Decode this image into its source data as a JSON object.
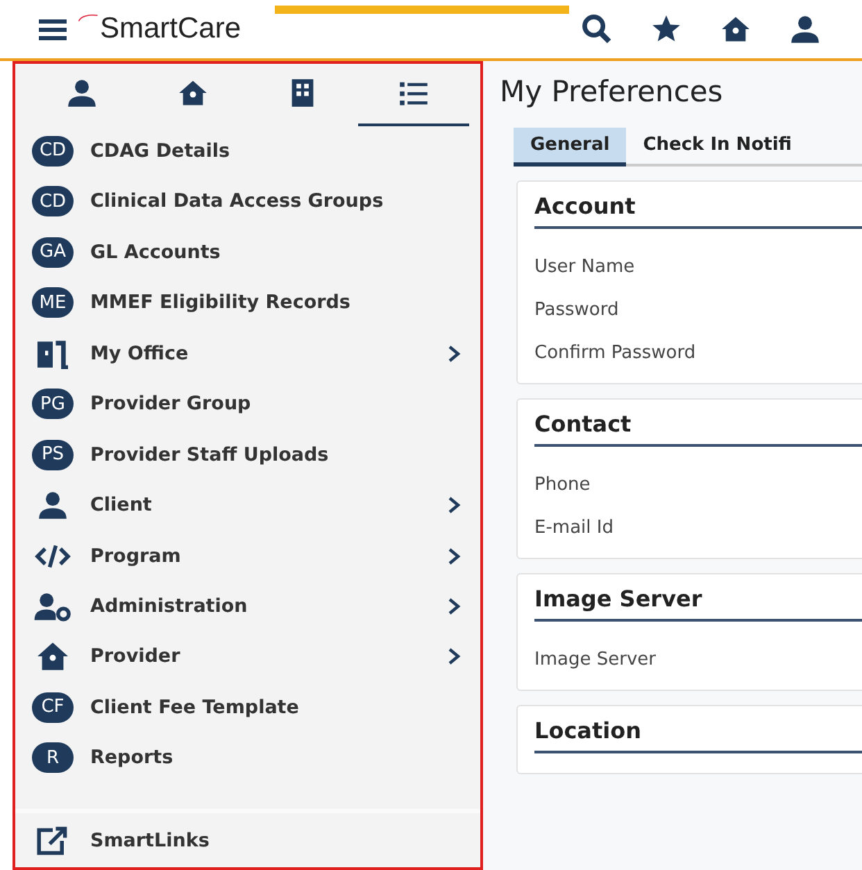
{
  "header": {
    "logo": "SmartCare"
  },
  "sidebar": {
    "tabs": [
      {
        "selected": false
      },
      {
        "selected": false
      },
      {
        "selected": false
      },
      {
        "selected": true
      }
    ],
    "items": [
      {
        "kind": "badge",
        "badge": "CD",
        "label": "CDAG Details",
        "submenu": false
      },
      {
        "kind": "badge",
        "badge": "CD",
        "label": "Clinical Data Access Groups",
        "submenu": false
      },
      {
        "kind": "badge",
        "badge": "GA",
        "label": "GL Accounts",
        "submenu": false
      },
      {
        "kind": "badge",
        "badge": "ME",
        "label": "MMEF Eligibility Records",
        "submenu": false
      },
      {
        "kind": "office",
        "label": "My Office",
        "submenu": true
      },
      {
        "kind": "badge",
        "badge": "PG",
        "label": "Provider Group",
        "submenu": false
      },
      {
        "kind": "badge",
        "badge": "PS",
        "label": "Provider Staff Uploads",
        "submenu": false
      },
      {
        "kind": "person",
        "label": "Client",
        "submenu": true
      },
      {
        "kind": "code",
        "label": "Program",
        "submenu": true
      },
      {
        "kind": "admin",
        "label": "Administration",
        "submenu": true
      },
      {
        "kind": "house",
        "label": "Provider",
        "submenu": true
      },
      {
        "kind": "badge",
        "badge": "CF",
        "label": "Client Fee Template",
        "submenu": false
      },
      {
        "kind": "badge",
        "badge": "R",
        "label": "Reports",
        "submenu": false
      }
    ],
    "footer_items": [
      {
        "kind": "link",
        "label": "SmartLinks"
      }
    ]
  },
  "page": {
    "title": "My Preferences",
    "tabs": [
      {
        "label": "General",
        "selected": true
      },
      {
        "label": "Check In Notifi",
        "selected": false
      }
    ],
    "sections": [
      {
        "title": "Account",
        "fields": [
          "User Name",
          "Password",
          "Confirm Password"
        ]
      },
      {
        "title": "Contact",
        "fields": [
          "Phone",
          "E-mail Id"
        ]
      },
      {
        "title": "Image Server",
        "fields": [
          "Image Server"
        ]
      },
      {
        "title": "Location"
      }
    ]
  }
}
